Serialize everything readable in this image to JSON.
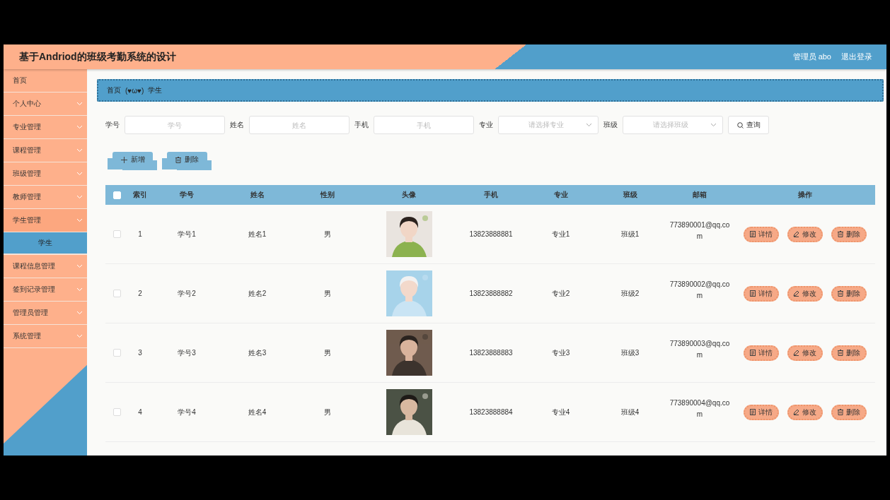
{
  "header": {
    "title": "基于Andriod的班级考勤系统的设计",
    "user": "管理员 abo",
    "logout": "退出登录"
  },
  "sidebar": {
    "items": [
      {
        "label": "首页",
        "kind": "link",
        "expanded": false,
        "selected": false
      },
      {
        "label": "个人中心",
        "kind": "group",
        "expanded": false,
        "selected": false
      },
      {
        "label": "专业管理",
        "kind": "group",
        "expanded": false,
        "selected": false
      },
      {
        "label": "课程管理",
        "kind": "group",
        "expanded": false,
        "selected": false
      },
      {
        "label": "班级管理",
        "kind": "group",
        "expanded": false,
        "selected": false
      },
      {
        "label": "教师管理",
        "kind": "group",
        "expanded": false,
        "selected": false
      },
      {
        "label": "学生管理",
        "kind": "group",
        "expanded": true,
        "selected": false,
        "children": [
          {
            "label": "学生",
            "selected": true
          }
        ]
      },
      {
        "label": "课程信息管理",
        "kind": "group",
        "expanded": false,
        "selected": false
      },
      {
        "label": "签到记录管理",
        "kind": "group",
        "expanded": false,
        "selected": false
      },
      {
        "label": "管理员管理",
        "kind": "group",
        "expanded": false,
        "selected": false
      },
      {
        "label": "系统管理",
        "kind": "group",
        "expanded": false,
        "selected": false
      }
    ]
  },
  "breadcrumb": {
    "home": "首页",
    "separator": "(♥ω♥)",
    "current": "学生"
  },
  "search": {
    "fields": [
      {
        "label": "学号",
        "placeholder": "学号",
        "kind": "input"
      },
      {
        "label": "姓名",
        "placeholder": "姓名",
        "kind": "input"
      },
      {
        "label": "手机",
        "placeholder": "手机",
        "kind": "input"
      },
      {
        "label": "专业",
        "placeholder": "请选择专业",
        "kind": "select"
      },
      {
        "label": "班级",
        "placeholder": "请选择班级",
        "kind": "select"
      }
    ],
    "button": "查询"
  },
  "toolbar": {
    "buttons": [
      {
        "label": "新增",
        "kind": "add"
      },
      {
        "label": "删除",
        "kind": "delete"
      }
    ]
  },
  "table": {
    "header_checked": false,
    "columns": [
      "索引",
      "学号",
      "姓名",
      "性别",
      "头像",
      "手机",
      "专业",
      "班级",
      "邮箱",
      "操作"
    ],
    "rows": [
      {
        "checked": false,
        "index": "1",
        "student_no": "学号1",
        "name": "姓名1",
        "gender": "男",
        "photo": {
          "kind": "picture"
        },
        "phone": "13823888881",
        "major": "专业1",
        "class": "班级1",
        "email": "773890001@qq.com",
        "actions": [
          {
            "label": "详情",
            "kind": "detail"
          },
          {
            "label": "修改",
            "kind": "edit"
          },
          {
            "label": "删除",
            "kind": "delete"
          }
        ]
      },
      {
        "checked": false,
        "index": "2",
        "student_no": "学号2",
        "name": "姓名2",
        "gender": "男",
        "photo": {
          "kind": "picture"
        },
        "phone": "13823888882",
        "major": "专业2",
        "class": "班级2",
        "email": "773890002@qq.com",
        "actions": [
          {
            "label": "详情",
            "kind": "detail"
          },
          {
            "label": "修改",
            "kind": "edit"
          },
          {
            "label": "删除",
            "kind": "delete"
          }
        ]
      },
      {
        "checked": false,
        "index": "3",
        "student_no": "学号3",
        "name": "姓名3",
        "gender": "男",
        "photo": {
          "kind": "picture"
        },
        "phone": "13823888883",
        "major": "专业3",
        "class": "班级3",
        "email": "773890003@qq.com",
        "actions": [
          {
            "label": "详情",
            "kind": "detail"
          },
          {
            "label": "修改",
            "kind": "edit"
          },
          {
            "label": "删除",
            "kind": "delete"
          }
        ]
      },
      {
        "checked": false,
        "index": "4",
        "student_no": "学号4",
        "name": "姓名4",
        "gender": "男",
        "photo": {
          "kind": "picture"
        },
        "phone": "13823888884",
        "major": "专业4",
        "class": "班级4",
        "email": "773890004@qq.com",
        "actions": [
          {
            "label": "详情",
            "kind": "detail"
          },
          {
            "label": "修改",
            "kind": "edit"
          },
          {
            "label": "删除",
            "kind": "delete"
          }
        ]
      }
    ]
  }
}
